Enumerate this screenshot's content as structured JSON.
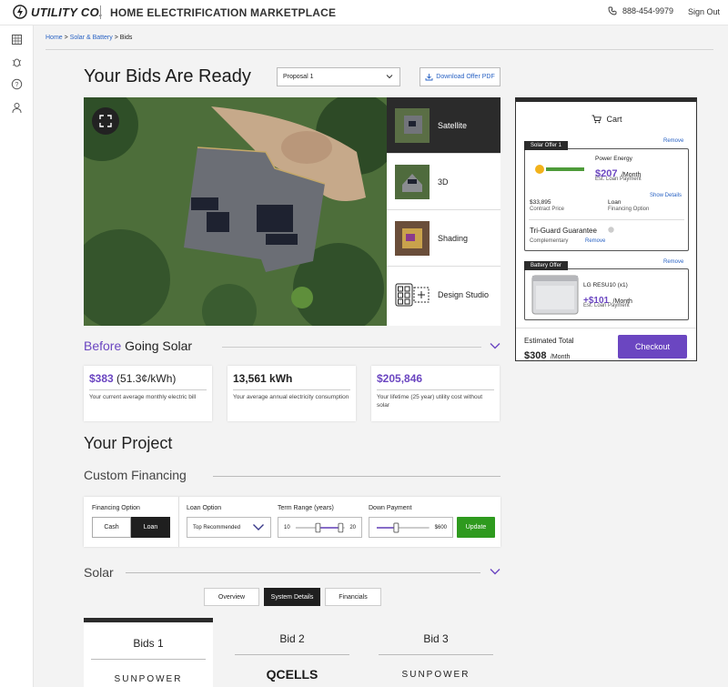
{
  "header": {
    "brand": "UTILITY CO.",
    "app_title": "HOME ELECTRIFICATION MARKETPLACE",
    "phone": "888-454-9979",
    "sign_out": "Sign Out"
  },
  "rail": {
    "icons": [
      "store-icon",
      "bug-icon",
      "help-icon",
      "user-icon"
    ]
  },
  "breadcrumb": {
    "home": "Home",
    "section": "Solar & Battery",
    "current": "Bids",
    "sep": ">"
  },
  "page": {
    "title": "Your Bids Are Ready",
    "proposal_select": "Proposal 1",
    "download_pdf": "Download Offer PDF"
  },
  "views": [
    {
      "label": "Satellite",
      "active": true
    },
    {
      "label": "3D",
      "active": false
    },
    {
      "label": "Shading",
      "active": false
    },
    {
      "label": "Design Studio",
      "active": false
    }
  ],
  "cart": {
    "title": "Cart",
    "solar_offer": {
      "tag": "Solar Offer 1",
      "remove": "Remove",
      "provider": "Power Energy",
      "price": "$207",
      "per": "/Month",
      "price_note": "Est. Loan Payment",
      "show_details": "Show Details",
      "contract_price": "$33,895",
      "contract_label": "Contract Price",
      "financing": "Loan",
      "financing_label": "Financing Option",
      "guarantee": "Tri-Guard Guarantee",
      "guarantee_note": "Complementary",
      "guarantee_remove": "Remove"
    },
    "battery_offer": {
      "tag": "Battery Offer",
      "remove": "Remove",
      "product": "LG RESU10 (x1)",
      "price": "+$101",
      "per": "/Month",
      "price_note": "Est. Loan Payment"
    },
    "total_label": "Estimated Total",
    "total": "$308",
    "total_per": "/Month",
    "checkout": "Checkout"
  },
  "before": {
    "title_highlight": "Before",
    "title_rest": "Going Solar",
    "stats": [
      {
        "value": "$383",
        "extra": "(51.3¢/kWh)",
        "desc": "Your current average monthly electric bill"
      },
      {
        "value": "13,561 kWh",
        "extra": "",
        "desc": "Your average annual electricity consumption"
      },
      {
        "value": "$205,846",
        "extra": "",
        "desc": "Your lifetime (25 year) utility cost without solar"
      }
    ]
  },
  "project": {
    "title": "Your Project",
    "financing_title": "Custom Financing",
    "financing_option_label": "Financing Option",
    "cash": "Cash",
    "loan": "Loan",
    "loan_option_label": "Loan Option",
    "loan_option_value": "Top Recommended",
    "term_label": "Term Range (years)",
    "term_min": "10",
    "term_max": "20",
    "down_label": "Down Payment",
    "down_value": "$600",
    "update": "Update"
  },
  "solar": {
    "title": "Solar",
    "tabs": [
      {
        "label": "Overview",
        "active": false
      },
      {
        "label": "System Details",
        "active": true
      },
      {
        "label": "Financials",
        "active": false
      }
    ]
  },
  "bids": [
    {
      "label": "Bids 1",
      "brand": "SUNPOWER",
      "active": true
    },
    {
      "label": "Bid 2",
      "brand": "QCELLS",
      "active": false
    },
    {
      "label": "Bid 3",
      "brand": "SUNPOWER",
      "active": false
    }
  ],
  "colors": {
    "accent": "#6b46c1",
    "link": "#2a63c4",
    "update": "#2e9a1e",
    "dark": "#2b2b2b"
  }
}
